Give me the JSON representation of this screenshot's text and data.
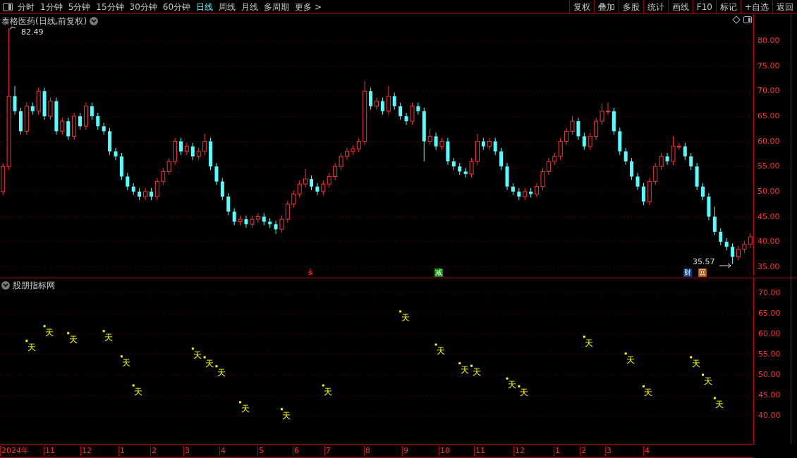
{
  "toolbar": {
    "periods": [
      {
        "label": "分时",
        "selected": false
      },
      {
        "label": "1分钟",
        "selected": false
      },
      {
        "label": "5分钟",
        "selected": false
      },
      {
        "label": "15分钟",
        "selected": false
      },
      {
        "label": "30分钟",
        "selected": false
      },
      {
        "label": "60分钟",
        "selected": false
      },
      {
        "label": "日线",
        "selected": true
      },
      {
        "label": "周线",
        "selected": false
      },
      {
        "label": "月线",
        "selected": false
      },
      {
        "label": "多周期",
        "selected": false
      },
      {
        "label": "更多 >",
        "selected": false
      }
    ],
    "actions": [
      "复权",
      "叠加",
      "多股",
      "统计",
      "画线",
      "F10",
      "标记",
      "+自选",
      "返回"
    ]
  },
  "price_panel": {
    "title": "泰格医药(日线,前复权)",
    "high_label": "82.49",
    "low_label": "35.57",
    "chart_data": {
      "type": "candlestick",
      "ylim": [
        32.73,
        85.33
      ],
      "grid": true,
      "yticks": [
        {
          "value": 80,
          "label": "80.00"
        },
        {
          "value": 75,
          "label": "75.00"
        },
        {
          "value": 70,
          "label": "70.00"
        },
        {
          "value": 65,
          "label": "65.00"
        },
        {
          "value": 60,
          "label": "60.00"
        },
        {
          "value": 55,
          "label": "55.00"
        },
        {
          "value": 50,
          "label": "50.00"
        },
        {
          "value": 45,
          "label": "45.00"
        },
        {
          "value": 40,
          "label": "40.00"
        },
        {
          "value": 35,
          "label": "35.00"
        }
      ],
      "categories": [
        null,
        null,
        null,
        null,
        null,
        null,
        null,
        null,
        null,
        null,
        null,
        null,
        null,
        null,
        null,
        null,
        null,
        null,
        null,
        null,
        null,
        null,
        null,
        null,
        null,
        null,
        null,
        null,
        null,
        null,
        null,
        null,
        null,
        null,
        null,
        null,
        null,
        null,
        null,
        null,
        null,
        null,
        null,
        null,
        null,
        null,
        null,
        null,
        null,
        null,
        null,
        null,
        null,
        null,
        null,
        null,
        null,
        null,
        null,
        null,
        null,
        null,
        null,
        null,
        null,
        null,
        null,
        null,
        null,
        null,
        null,
        null,
        null,
        null,
        null,
        null,
        null,
        null,
        null,
        null,
        null,
        null,
        null,
        null,
        null,
        null,
        null,
        null,
        null,
        null,
        null,
        null,
        null,
        null,
        null,
        null,
        null,
        null,
        null,
        null,
        null,
        null,
        null,
        null,
        null,
        null,
        null,
        null,
        null,
        null,
        null,
        null,
        null,
        null,
        null,
        null,
        null,
        null,
        null,
        null,
        null,
        null,
        null,
        null,
        null,
        null,
        null
      ],
      "ohlc": [
        [
          50,
          55.7,
          49.3,
          55
        ],
        [
          55,
          82.49,
          54.3,
          69
        ],
        [
          69,
          71,
          65.3,
          66
        ],
        [
          66,
          66.7,
          61.3,
          62
        ],
        [
          62,
          67.7,
          61.3,
          67
        ],
        [
          67,
          67.7,
          65.3,
          66
        ],
        [
          66,
          70.7,
          65.3,
          70
        ],
        [
          70,
          70.7,
          64.3,
          65
        ],
        [
          65,
          68.7,
          64.3,
          68
        ],
        [
          68,
          68.7,
          61.3,
          62
        ],
        [
          62,
          64.7,
          61.3,
          64
        ],
        [
          64,
          64.7,
          60.3,
          61
        ],
        [
          61,
          65.7,
          60.3,
          65
        ],
        [
          65,
          65.7,
          62.3,
          63
        ],
        [
          63,
          67.7,
          62.3,
          67
        ],
        [
          67,
          67.7,
          64.3,
          65
        ],
        [
          65,
          65.7,
          62.3,
          63
        ],
        [
          63,
          63.7,
          61.3,
          62
        ],
        [
          62,
          62.7,
          57.3,
          58
        ],
        [
          58,
          58.7,
          56.3,
          57
        ],
        [
          57,
          57.7,
          52.3,
          53
        ],
        [
          53,
          53.7,
          50.3,
          51
        ],
        [
          51,
          51.7,
          49.3,
          50
        ],
        [
          50,
          50.7,
          48.3,
          49
        ],
        [
          49,
          50.7,
          48.3,
          50
        ],
        [
          50,
          50.7,
          48.3,
          49
        ],
        [
          49,
          52.7,
          48.3,
          52
        ],
        [
          52,
          54.7,
          51.3,
          54
        ],
        [
          54,
          56.7,
          53.3,
          56
        ],
        [
          56,
          60.7,
          55.3,
          60
        ],
        [
          60,
          60.7,
          57.3,
          58
        ],
        [
          58,
          59.7,
          57.3,
          59
        ],
        [
          59,
          59.7,
          56.3,
          57
        ],
        [
          57,
          58.7,
          56.3,
          58
        ],
        [
          58,
          61.5,
          57.3,
          60
        ],
        [
          60,
          60.7,
          54.3,
          55
        ],
        [
          55,
          55.7,
          51.3,
          52
        ],
        [
          52,
          52.7,
          48.3,
          49
        ],
        [
          49,
          49.7,
          45.3,
          46
        ],
        [
          46,
          46.7,
          43.3,
          44
        ],
        [
          44,
          45.2,
          43.3,
          44.5
        ],
        [
          44.5,
          45.2,
          42.8,
          43.5
        ],
        [
          43.5,
          45.2,
          42.8,
          44.5
        ],
        [
          44.5,
          45.7,
          43.8,
          45
        ],
        [
          45,
          45.7,
          43.3,
          44
        ],
        [
          44,
          44.7,
          42.8,
          43.5
        ],
        [
          43.5,
          44.2,
          41.6,
          42.5
        ],
        [
          42.5,
          45.2,
          41.8,
          44.5
        ],
        [
          44.5,
          48.2,
          43.8,
          47.5
        ],
        [
          47.5,
          50.2,
          46.8,
          49.5
        ],
        [
          49.5,
          52.2,
          48.8,
          51.5
        ],
        [
          51.5,
          54.5,
          50.8,
          52.5
        ],
        [
          52.5,
          53.2,
          50.3,
          51
        ],
        [
          51,
          51.7,
          49.3,
          50
        ],
        [
          50,
          52.2,
          49.3,
          51.5
        ],
        [
          51.5,
          53.7,
          50.8,
          53
        ],
        [
          53,
          55.7,
          52.3,
          55
        ],
        [
          55,
          57.7,
          54.3,
          57
        ],
        [
          57,
          58.7,
          56.3,
          58
        ],
        [
          58,
          59.2,
          57.3,
          58.5
        ],
        [
          58.5,
          60.7,
          57.8,
          60
        ],
        [
          60,
          72,
          59.3,
          70
        ],
        [
          70,
          70.7,
          66.3,
          67
        ],
        [
          67,
          68.7,
          66.3,
          68
        ],
        [
          68,
          68.7,
          65.3,
          66
        ],
        [
          66,
          71,
          65.3,
          69
        ],
        [
          69,
          69.7,
          66.3,
          67
        ],
        [
          67,
          67.7,
          64.3,
          65
        ],
        [
          65,
          65.7,
          63.3,
          64
        ],
        [
          64,
          67.7,
          63.3,
          67
        ],
        [
          67,
          67.7,
          65.3,
          66
        ],
        [
          66,
          66.7,
          56,
          60
        ],
        [
          60,
          62.5,
          59.3,
          61
        ],
        [
          61,
          61.7,
          58.3,
          59
        ],
        [
          59,
          60.7,
          58.3,
          60
        ],
        [
          60,
          60.7,
          55.3,
          56
        ],
        [
          56,
          56.7,
          54.3,
          55
        ],
        [
          55,
          55.7,
          53.3,
          54
        ],
        [
          54,
          54.7,
          52.8,
          53.5
        ],
        [
          53.5,
          56.7,
          52.8,
          56
        ],
        [
          56,
          61.5,
          55.3,
          60
        ],
        [
          60,
          60.7,
          58.3,
          59
        ],
        [
          59,
          60.7,
          58.3,
          60
        ],
        [
          60,
          60.7,
          57.3,
          58
        ],
        [
          58,
          58.7,
          54.3,
          55
        ],
        [
          55,
          55.7,
          50.3,
          51
        ],
        [
          51,
          51.7,
          49.3,
          50
        ],
        [
          50,
          50.7,
          48.3,
          49
        ],
        [
          49,
          50.7,
          48.3,
          50
        ],
        [
          50,
          50.7,
          48.8,
          49.5
        ],
        [
          49.5,
          51.7,
          48.8,
          51
        ],
        [
          51,
          54.7,
          50.3,
          54
        ],
        [
          54,
          56.7,
          53.3,
          56
        ],
        [
          56,
          57.7,
          55.3,
          57
        ],
        [
          57,
          60.7,
          56.3,
          60
        ],
        [
          60,
          62.7,
          59.3,
          62
        ],
        [
          62,
          65,
          61.3,
          64
        ],
        [
          64,
          64.7,
          60.3,
          61
        ],
        [
          61,
          61.7,
          58.3,
          59
        ],
        [
          59,
          61.7,
          58.3,
          61
        ],
        [
          61,
          64.7,
          60.3,
          64
        ],
        [
          64,
          67.5,
          63.3,
          66
        ],
        [
          66,
          67.7,
          65.3,
          66
        ],
        [
          66,
          66.7,
          61.3,
          62
        ],
        [
          62,
          62.7,
          57.3,
          58
        ],
        [
          58,
          58.7,
          55.3,
          56
        ],
        [
          56,
          56.7,
          52.3,
          53
        ],
        [
          53,
          53.7,
          50.3,
          51
        ],
        [
          51,
          51.7,
          47.3,
          48
        ],
        [
          48,
          52.7,
          47.3,
          52
        ],
        [
          52,
          55.7,
          51.3,
          55
        ],
        [
          55,
          57.7,
          54.3,
          57
        ],
        [
          57,
          57.7,
          55.3,
          56
        ],
        [
          56,
          61,
          55.3,
          59
        ],
        [
          59,
          59.7,
          58.3,
          59
        ],
        [
          59,
          59.7,
          56.3,
          57
        ],
        [
          57,
          57.7,
          54.3,
          55
        ],
        [
          55,
          55.7,
          50.3,
          51
        ],
        [
          51,
          51.7,
          48.3,
          49
        ],
        [
          49,
          49.7,
          44.3,
          45
        ],
        [
          45,
          47,
          41.3,
          42
        ],
        [
          42,
          42.7,
          39.3,
          40
        ],
        [
          40,
          40.7,
          38.3,
          39
        ],
        [
          39,
          39.7,
          35.57,
          37
        ],
        [
          37,
          39.2,
          36.3,
          38.5
        ],
        [
          38.5,
          40.2,
          37.8,
          39.5
        ],
        [
          39.5,
          41.7,
          38.8,
          41
        ]
      ]
    },
    "events": [
      {
        "kind": "dividend",
        "text": "ŝ"
      },
      {
        "kind": "reduce",
        "text": "减"
      },
      {
        "kind": "finance",
        "text": "财"
      },
      {
        "kind": "buyback",
        "text": "回"
      }
    ]
  },
  "indicator_panel": {
    "title": "股朋指标网",
    "chart_data": {
      "type": "scatter",
      "ylim": [
        33.1,
        73.6
      ],
      "grid": true,
      "categories": [
        null,
        null,
        null,
        null,
        null,
        null,
        null,
        null,
        null,
        null,
        null,
        null,
        null,
        null,
        null,
        null,
        null,
        null,
        null,
        null,
        null,
        null,
        null,
        null,
        null,
        null,
        null,
        null,
        null,
        null,
        null,
        null,
        null,
        null,
        null,
        null,
        null,
        null,
        null,
        null,
        null,
        null,
        null,
        null,
        null,
        null,
        null,
        null,
        null,
        null,
        null,
        null,
        null,
        null,
        null,
        null,
        null,
        null,
        null,
        null,
        null,
        null,
        null,
        null,
        null,
        null,
        null,
        null,
        null,
        null,
        null,
        null,
        null,
        null,
        null,
        null,
        null,
        null,
        null,
        null,
        null,
        null,
        null,
        null,
        null,
        null,
        null,
        null,
        null,
        null,
        null,
        null,
        null,
        null,
        null,
        null,
        null,
        null,
        null,
        null,
        null,
        null,
        null,
        null,
        null,
        null,
        null,
        null,
        null,
        null,
        null,
        null,
        null,
        null,
        null,
        null,
        null,
        null,
        null,
        null,
        null,
        null,
        null,
        null,
        null,
        null,
        null
      ],
      "values": [
        null,
        null,
        null,
        null,
        58.3,
        null,
        null,
        61.9,
        null,
        null,
        null,
        60.2,
        null,
        null,
        null,
        null,
        null,
        60.7,
        null,
        null,
        54.5,
        null,
        47.4,
        null,
        null,
        null,
        null,
        null,
        null,
        null,
        null,
        null,
        56.4,
        null,
        54.3,
        null,
        52.1,
        null,
        null,
        null,
        43.3,
        null,
        null,
        null,
        null,
        null,
        null,
        41.6,
        null,
        null,
        null,
        null,
        null,
        null,
        47.4,
        null,
        null,
        null,
        null,
        null,
        null,
        null,
        null,
        null,
        null,
        null,
        null,
        65.5,
        null,
        null,
        null,
        null,
        null,
        57.4,
        null,
        null,
        null,
        52.8,
        null,
        52.2,
        null,
        null,
        null,
        null,
        null,
        49.1,
        null,
        47.2,
        null,
        null,
        null,
        null,
        null,
        null,
        null,
        null,
        null,
        null,
        59.3,
        null,
        null,
        null,
        null,
        null,
        null,
        55.2,
        null,
        null,
        47.2,
        null,
        null,
        null,
        null,
        null,
        null,
        null,
        54.3,
        null,
        50.0,
        null,
        44.3,
        null,
        null,
        null,
        null,
        null,
        null
      ],
      "value_labels": [
        null,
        null,
        null,
        null,
        "天",
        null,
        null,
        "天",
        null,
        null,
        null,
        "天",
        null,
        null,
        null,
        null,
        null,
        "天",
        null,
        null,
        "天",
        null,
        "天",
        null,
        null,
        null,
        null,
        null,
        null,
        null,
        null,
        null,
        "天",
        null,
        "天",
        null,
        "天",
        null,
        null,
        null,
        "天",
        null,
        null,
        null,
        null,
        null,
        null,
        "天",
        null,
        null,
        null,
        null,
        null,
        null,
        "天",
        null,
        null,
        null,
        null,
        null,
        null,
        null,
        null,
        null,
        null,
        null,
        null,
        "天",
        null,
        null,
        null,
        null,
        null,
        "天",
        null,
        null,
        null,
        "天",
        null,
        "天",
        null,
        null,
        null,
        null,
        null,
        "天",
        null,
        "天",
        null,
        null,
        null,
        null,
        null,
        null,
        null,
        null,
        null,
        null,
        "天",
        null,
        null,
        null,
        null,
        null,
        null,
        "天",
        null,
        null,
        "天",
        null,
        null,
        null,
        null,
        null,
        null,
        null,
        "天",
        null,
        "天",
        null,
        "天",
        null,
        null,
        null,
        null,
        null,
        null
      ],
      "yticks": [
        {
          "value": 70,
          "label": "70.00"
        },
        {
          "value": 65,
          "label": "65.00"
        },
        {
          "value": 60,
          "label": "60.00"
        },
        {
          "value": 55,
          "label": "55.00"
        },
        {
          "value": 50,
          "label": "50.00"
        },
        {
          "value": 45,
          "label": "45.00"
        },
        {
          "value": 40,
          "label": "40.00"
        }
      ]
    }
  },
  "date_axis": [
    "2024年",
    "11",
    "12",
    "1",
    "2",
    "3",
    "4",
    "5",
    "6",
    "7",
    "8",
    "9",
    "10",
    "11",
    "12",
    "1",
    "2",
    "3",
    "4"
  ]
}
